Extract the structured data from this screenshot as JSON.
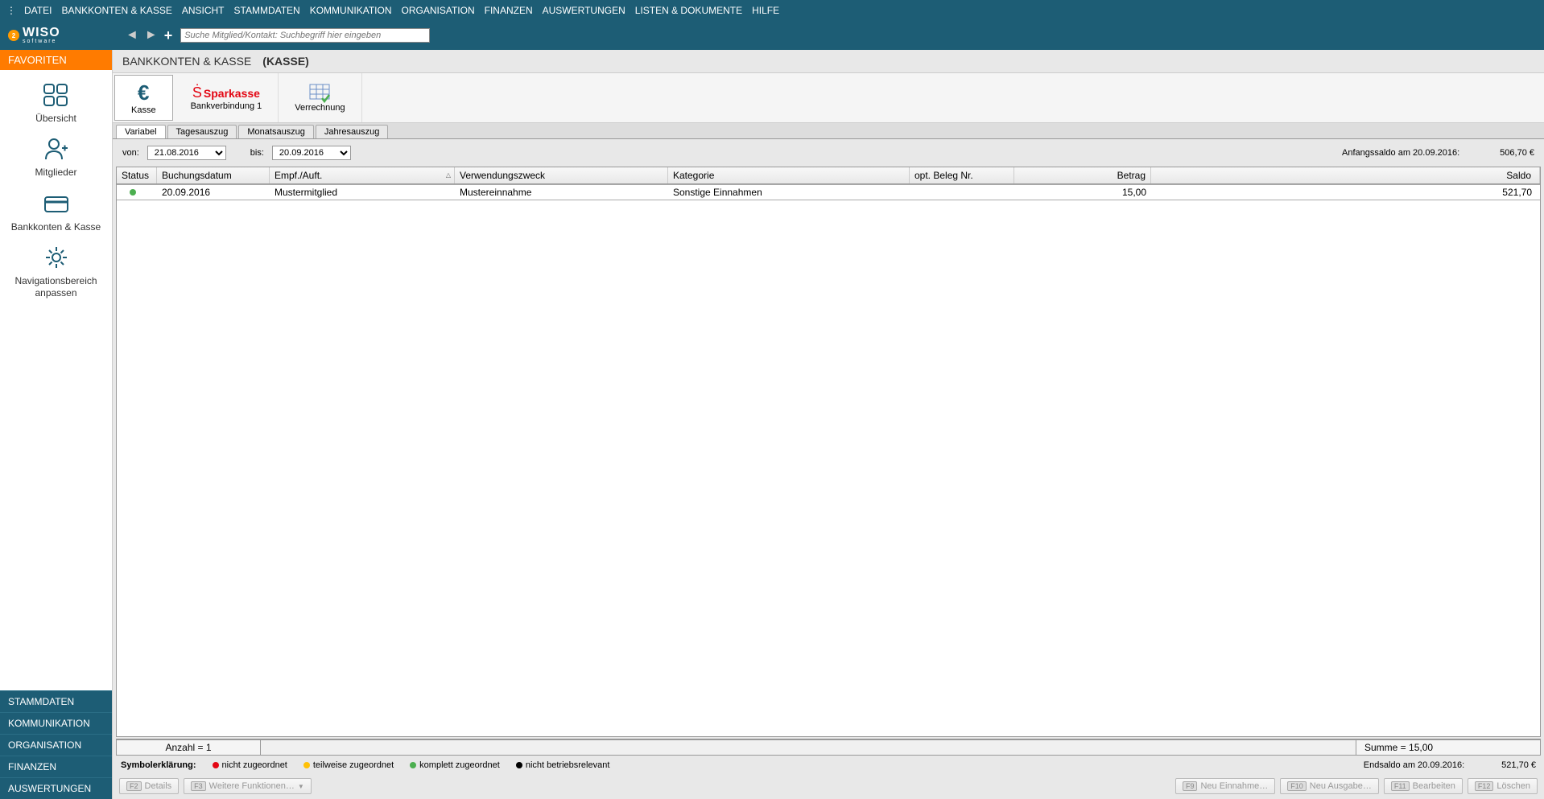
{
  "topmenu": [
    "DATEI",
    "BANKKONTEN & KASSE",
    "ANSICHT",
    "STAMMDATEN",
    "KOMMUNIKATION",
    "ORGANISATION",
    "FINANZEN",
    "AUSWERTUNGEN",
    "LISTEN & DOKUMENTE",
    "HILFE"
  ],
  "logo": {
    "brand": "WISO",
    "sub": "software",
    "badge": "2"
  },
  "search": {
    "placeholder": "Suche Mitglied/Kontakt: Suchbegriff hier eingeben"
  },
  "sidebar": {
    "header": "FAVORITEN",
    "items": [
      {
        "label": "Übersicht"
      },
      {
        "label": "Mitglieder"
      },
      {
        "label": "Bankkonten & Kasse"
      },
      {
        "label": "Navigationsbereich anpassen"
      }
    ],
    "bottom": [
      "STAMMDATEN",
      "KOMMUNIKATION",
      "ORGANISATION",
      "FINANZEN",
      "AUSWERTUNGEN"
    ]
  },
  "header": {
    "title1": "BANKKONTEN & KASSE",
    "title2": "(KASSE)"
  },
  "toolbar": {
    "kasse": "Kasse",
    "sparkasse": "Sparkasse",
    "bankverbindung": "Bankverbindung 1",
    "verrechnung": "Verrechnung"
  },
  "tabs": [
    "Variabel",
    "Tagesauszug",
    "Monatsauszug",
    "Jahresauszug"
  ],
  "filter": {
    "von_label": "von:",
    "von_value": "21.08.2016",
    "bis_label": "bis:",
    "bis_value": "20.09.2016",
    "anfang_label": "Anfangssaldo am 20.09.2016:",
    "anfang_value": "506,70 €"
  },
  "columns": {
    "status": "Status",
    "date": "Buchungsdatum",
    "empf": "Empf./Auft.",
    "zweck": "Verwendungszweck",
    "kat": "Kategorie",
    "beleg": "opt. Beleg Nr.",
    "betrag": "Betrag",
    "saldo": "Saldo"
  },
  "rows": [
    {
      "date": "20.09.2016",
      "empf": "Mustermitglied",
      "zweck": "Mustereinnahme",
      "kat": "Sonstige Einnahmen",
      "beleg": "",
      "betrag": "15,00",
      "saldo": "521,70"
    }
  ],
  "summary": {
    "left": "Anzahl = 1",
    "right": "Summe = 15,00"
  },
  "legend": {
    "title": "Symbolerklärung:",
    "red": "nicht zugeordnet",
    "yellow": "teilweise zugeordnet",
    "green": "komplett zugeordnet",
    "black": "nicht betriebsrelevant",
    "end_label": "Endsaldo am 20.09.2016:",
    "end_value": "521,70 €"
  },
  "buttons": {
    "details": "Details",
    "weitere": "Weitere Funktionen…",
    "neu_ein": "Neu Einnahme…",
    "neu_aus": "Neu Ausgabe…",
    "bearbeiten": "Bearbeiten",
    "loeschen": "Löschen",
    "f2": "F2",
    "f3": "F3",
    "f9": "F9",
    "f10": "F10",
    "f11": "F11",
    "f12": "F12"
  }
}
